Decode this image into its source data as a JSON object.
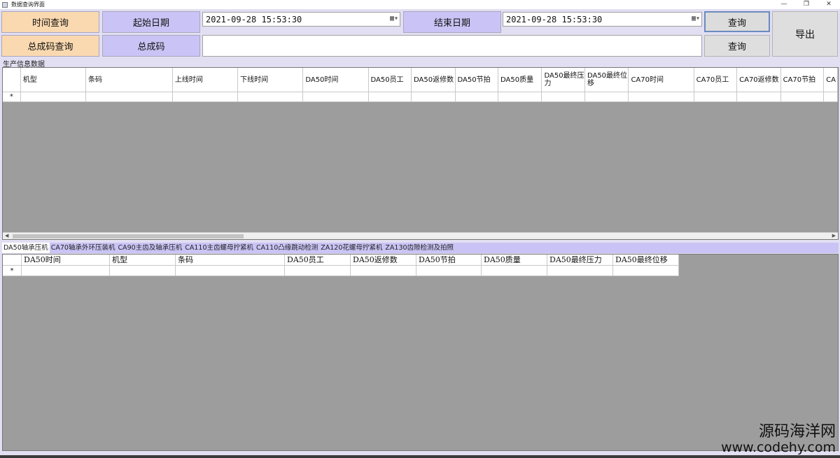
{
  "window": {
    "title": "数据查询界面",
    "controls": [
      "—",
      "❐",
      "✕"
    ]
  },
  "toolbar": {
    "time_query": "时间查询",
    "code_query": "总成码查询",
    "start_date_label": "起始日期",
    "end_date_label": "结束日期",
    "total_code_label": "总成码",
    "start_date_value": "2021-09-28   15:53:30",
    "end_date_value": "2021-09-28   15:53:30",
    "query_button_1": "查询",
    "query_button_2": "查询",
    "export_button": "导出",
    "code_input_value": ""
  },
  "production": {
    "section_label": "生产信息数据",
    "columns": [
      "机型",
      "条码",
      "上线时间",
      "下线时间",
      "DA50时间",
      "DA50员工",
      "DA50返修数",
      "DA50节拍",
      "DA50质量",
      "DA50最终压力",
      "DA50最终位移",
      "CA70时间",
      "CA70员工",
      "CA70返修数",
      "CA70节拍",
      "CA"
    ],
    "new_row_marker": "*"
  },
  "tabs": [
    "DA50轴承压机",
    "CA70轴承外环压装机",
    "CA90主齿及轴承压机",
    "CA110主齿螺母拧紧机",
    "CA110凸缘跳动检测",
    "ZA120花螺母拧紧机",
    "ZA130齿隙检测及拍照"
  ],
  "detail": {
    "columns": [
      "DA50时间",
      "机型",
      "条码",
      "DA50员工",
      "DA50返修数",
      "DA50节拍",
      "DA50质量",
      "DA50最终压力",
      "DA50最终位移"
    ],
    "new_row_marker": "*"
  },
  "watermark": {
    "line1": "源码海洋网",
    "line2": "www.codehy.com"
  }
}
